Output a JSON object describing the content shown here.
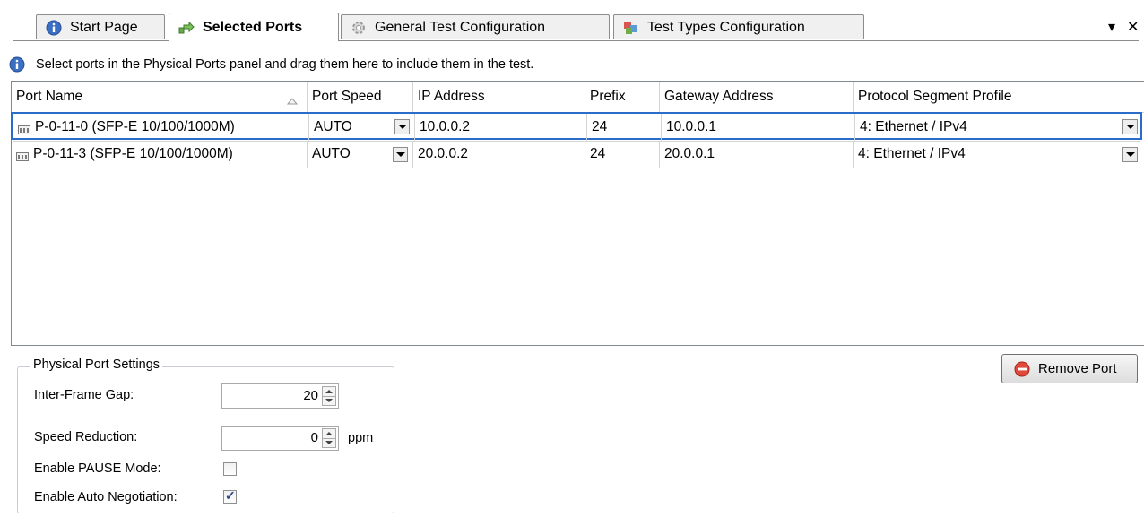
{
  "tabs": [
    {
      "label": "Start Page",
      "icon": "info-icon"
    },
    {
      "label": "Selected Ports",
      "icon": "ports-arrow-icon"
    },
    {
      "label": "General Test Configuration",
      "icon": "gear-icon"
    },
    {
      "label": "Test Types Configuration",
      "icon": "cubes-icon"
    }
  ],
  "strip_controls": {
    "menu": "▾",
    "close": "✕"
  },
  "info_text": "Select ports in the Physical Ports panel and drag them here to include them in the test.",
  "grid": {
    "columns": [
      "Port Name",
      "Port Speed",
      "IP Address",
      "Prefix",
      "Gateway Address",
      "Protocol Segment Profile"
    ],
    "rows": [
      {
        "port_name": "P-0-11-0 (SFP-E 10/100/1000M)",
        "port_speed": "AUTO",
        "ip_address": "10.0.0.2",
        "prefix": "24",
        "gateway": "10.0.0.1",
        "profile": "4: Ethernet / IPv4"
      },
      {
        "port_name": "P-0-11-3 (SFP-E 10/100/1000M)",
        "port_speed": "AUTO",
        "ip_address": "20.0.0.2",
        "prefix": "24",
        "gateway": "20.0.0.1",
        "profile": "4: Ethernet / IPv4"
      }
    ]
  },
  "settings": {
    "title": "Physical Port Settings",
    "inter_frame_gap_label": "Inter-Frame Gap:",
    "inter_frame_gap_value": "20",
    "speed_reduction_label": "Speed Reduction:",
    "speed_reduction_value": "0",
    "speed_reduction_unit": "ppm",
    "pause_mode_label": "Enable PAUSE Mode:",
    "pause_mode_checked": false,
    "auto_neg_label": "Enable Auto Negotiation:",
    "auto_neg_checked": true
  },
  "remove_button": "Remove Port",
  "colors": {
    "selection": "#2a6cc9",
    "remove_icon": "#e04a3c"
  }
}
